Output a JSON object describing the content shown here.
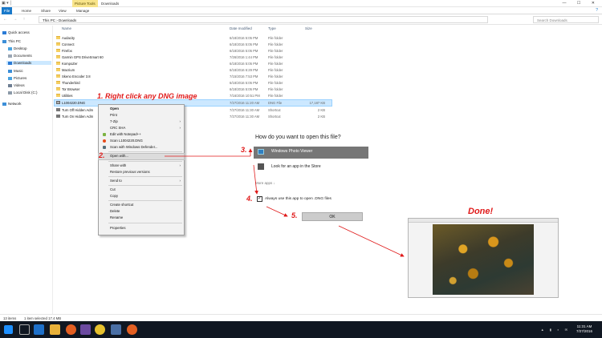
{
  "titlebar": {
    "context_tab": "Picture Tools",
    "title": "Downloads",
    "controls": "— ☐ ✕"
  },
  "ribbon": {
    "tabs": [
      "File",
      "Home",
      "Share",
      "View",
      "Manage"
    ],
    "help": "?"
  },
  "address": {
    "path": "This PC  ›  Downloads",
    "search_placeholder": "Search Downloads"
  },
  "nav": {
    "items": [
      "Quick access",
      "This PC",
      "Desktop",
      "Documents",
      "Downloads",
      "Music",
      "Pictures",
      "Videos",
      "Local Disk (C:)",
      "Network"
    ]
  },
  "columns": {
    "name": "Name",
    "date": "Date modified",
    "type": "Type",
    "size": "Size"
  },
  "files": [
    {
      "name": "Audacity",
      "date": "6/18/2016 5:05 PM",
      "type": "File folder",
      "size": ""
    },
    {
      "name": "Connect",
      "date": "6/18/2016 5:05 PM",
      "type": "File folder",
      "size": ""
    },
    {
      "name": "Firefox",
      "date": "6/18/2016 5:05 PM",
      "type": "File folder",
      "size": ""
    },
    {
      "name": "Garmin GPS DriveSmart 60",
      "date": "7/26/2016 1:44 PM",
      "type": "File folder",
      "size": ""
    },
    {
      "name": "KompoZer",
      "date": "6/18/2016 5:05 PM",
      "type": "File folder",
      "size": ""
    },
    {
      "name": "Macrium",
      "date": "6/18/2016 6:29 PM",
      "type": "File folder",
      "size": ""
    },
    {
      "name": "Skeno Encoder 3.8",
      "date": "7/15/2016 7:53 PM",
      "type": "File folder",
      "size": ""
    },
    {
      "name": "Thunderbird",
      "date": "6/18/2016 5:05 PM",
      "type": "File folder",
      "size": ""
    },
    {
      "name": "Tor Browser",
      "date": "6/18/2016 5:05 PM",
      "type": "File folder",
      "size": ""
    },
    {
      "name": "Utilities",
      "date": "7/16/2016 10:51 PM",
      "type": "File folder",
      "size": ""
    },
    {
      "name": "L1004220.DNG",
      "date": "7/27/2016 11:20 AM",
      "type": "DNG File",
      "size": "17,187 KB"
    },
    {
      "name": "Turn Off Hidden Adm",
      "date": "7/27/2016 11:30 AM",
      "type": "Shortcut",
      "size": "2 KB"
    },
    {
      "name": "Turn On Hidden Adm",
      "date": "7/27/2016 11:30 AM",
      "type": "Shortcut",
      "size": "2 KB"
    }
  ],
  "menu": {
    "items": [
      "Open",
      "Print",
      "7-Zip",
      "CRC SHA",
      "Edit with Notepad++",
      "Scan L1004220.DNG",
      "Scan with Windows Defender...",
      "Open with...",
      "Share with",
      "Restore previous versions",
      "Send to",
      "Cut",
      "Copy",
      "Create shortcut",
      "Delete",
      "Rename",
      "Properties"
    ],
    "arrow": "›"
  },
  "dialog": {
    "question": "How do you want to open this file?",
    "option1": "Windows Photo Viewer",
    "option2": "Look for an app in the Store",
    "more": "More apps  ↓",
    "checkbox_mark": "✓",
    "checkbox_label": "Always use this app to open .DNG files",
    "ok": "OK"
  },
  "annotations": {
    "step1": "1. Right click any DNG image",
    "step2": "2.",
    "step3": "3.",
    "step4": "4.",
    "step5": "5.",
    "done": "Done!"
  },
  "status": {
    "count": "13 items",
    "selection": "1 item selected  17.4 MB"
  },
  "taskbar": {
    "time": "11:31 AM",
    "date": "7/27/2016"
  },
  "colors": {
    "accent": "#1979ca",
    "annotation": "#e01a1a",
    "selection": "#cce8ff",
    "folder": "#f5cf62"
  }
}
